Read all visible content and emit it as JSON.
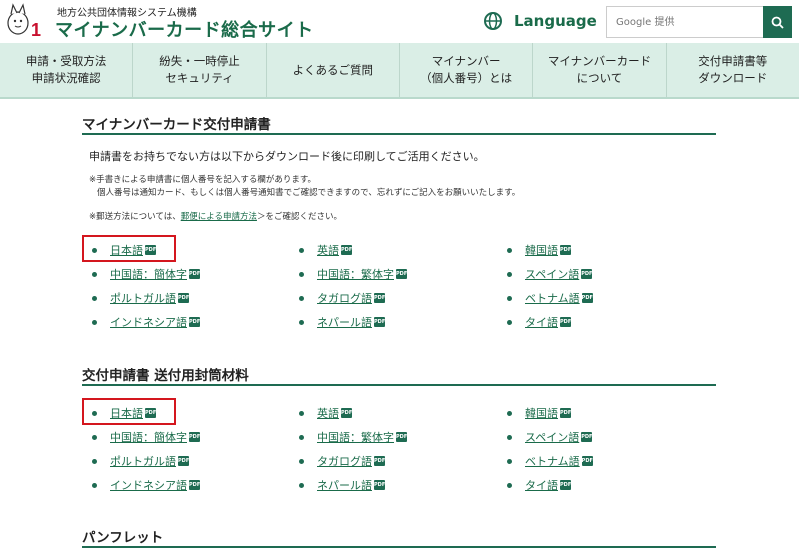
{
  "header": {
    "org_name": "地方公共団体情報システム機構",
    "site_title": "マイナンバーカード総合サイト",
    "language_label": "Language",
    "search_placeholder": "Google 提供"
  },
  "nav": [
    "申請・受取方法\n申請状況確認",
    "紛失・一時停止\nセキュリティ",
    "よくあるご質問",
    "マイナンバー\n（個人番号）とは",
    "マイナンバーカード\nについて",
    "交付申請書等\nダウンロード"
  ],
  "section1": {
    "title": "マイナンバーカード交付申請書",
    "intro": "申請書をお持ちでない方は以下からダウンロード後に印刷してご活用ください。",
    "note1": "※手書きによる申請書に個人番号を記入する欄があります。",
    "note2": "個人番号は通知カード、もしくは個人番号通知書でご確認できますので、忘れずにご記入をお願いいたします。",
    "note3_prefix": "※郵送方法については、",
    "note3_link": "郵便による申請方法",
    "note3_suffix": "＞をご確認ください。",
    "languages": [
      "日本語",
      "英語",
      "韓国語",
      "中国語：簡体字",
      "中国語：繁体字",
      "スペイン語",
      "ポルトガル語",
      "タガログ語",
      "ベトナム語",
      "インドネシア語",
      "ネパール語",
      "タイ語"
    ]
  },
  "section2": {
    "title": "交付申請書 送付用封筒材料",
    "languages": [
      "日本語",
      "英語",
      "韓国語",
      "中国語：簡体字",
      "中国語：繁体字",
      "スペイン語",
      "ポルトガル語",
      "タガログ語",
      "ベトナム語",
      "インドネシア語",
      "ネパール語",
      "タイ語"
    ]
  },
  "section3": {
    "title": "パンフレット"
  },
  "pdf_badge": "PDF",
  "colors": {
    "brand_green": "#1e6b52",
    "nav_bg": "#daeee6",
    "highlight_red": "#d4161e"
  }
}
